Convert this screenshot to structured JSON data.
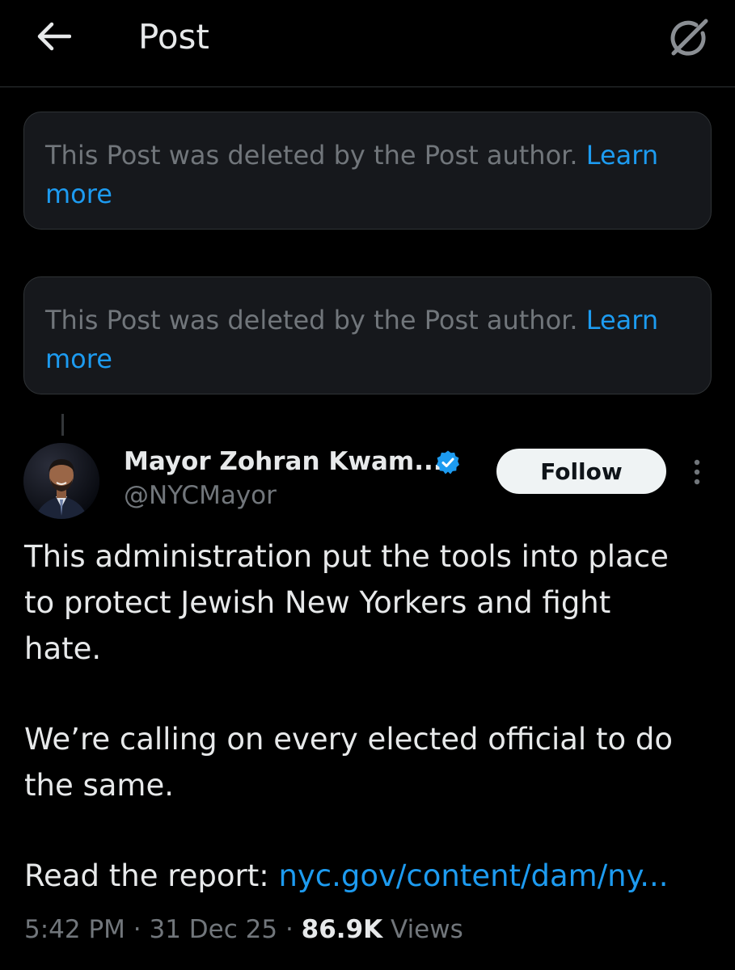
{
  "header": {
    "title": "Post",
    "back_icon": "arrow-left-icon",
    "grok_icon": "grok-slash-icon"
  },
  "deleted_notices": [
    {
      "text": "This Post was deleted by the Post author.",
      "link": "Learn more"
    },
    {
      "text": "This Post was deleted by the Post author.",
      "link": "Learn more"
    }
  ],
  "post": {
    "author_name": "Mayor Zohran Kwam...",
    "handle": "@NYCMayor",
    "verified": true,
    "follow_label": "Follow",
    "body_lines": [
      "This administration put the tools into place",
      "to protect Jewish New Yorkers and fight",
      "hate."
    ],
    "body_lines_2": [
      "We’re calling on every elected official to do",
      "the same."
    ],
    "read_prefix": "Read the report: ",
    "read_link": "nyc.gov/content/dam/ny...",
    "time": "5:42 PM",
    "date": "31 Dec 25",
    "views_count": "86.9K",
    "views_label": "Views"
  },
  "colors": {
    "background": "#000000",
    "link": "#1d9bf0",
    "muted": "#71767b",
    "verified": "#1d9bf0"
  }
}
